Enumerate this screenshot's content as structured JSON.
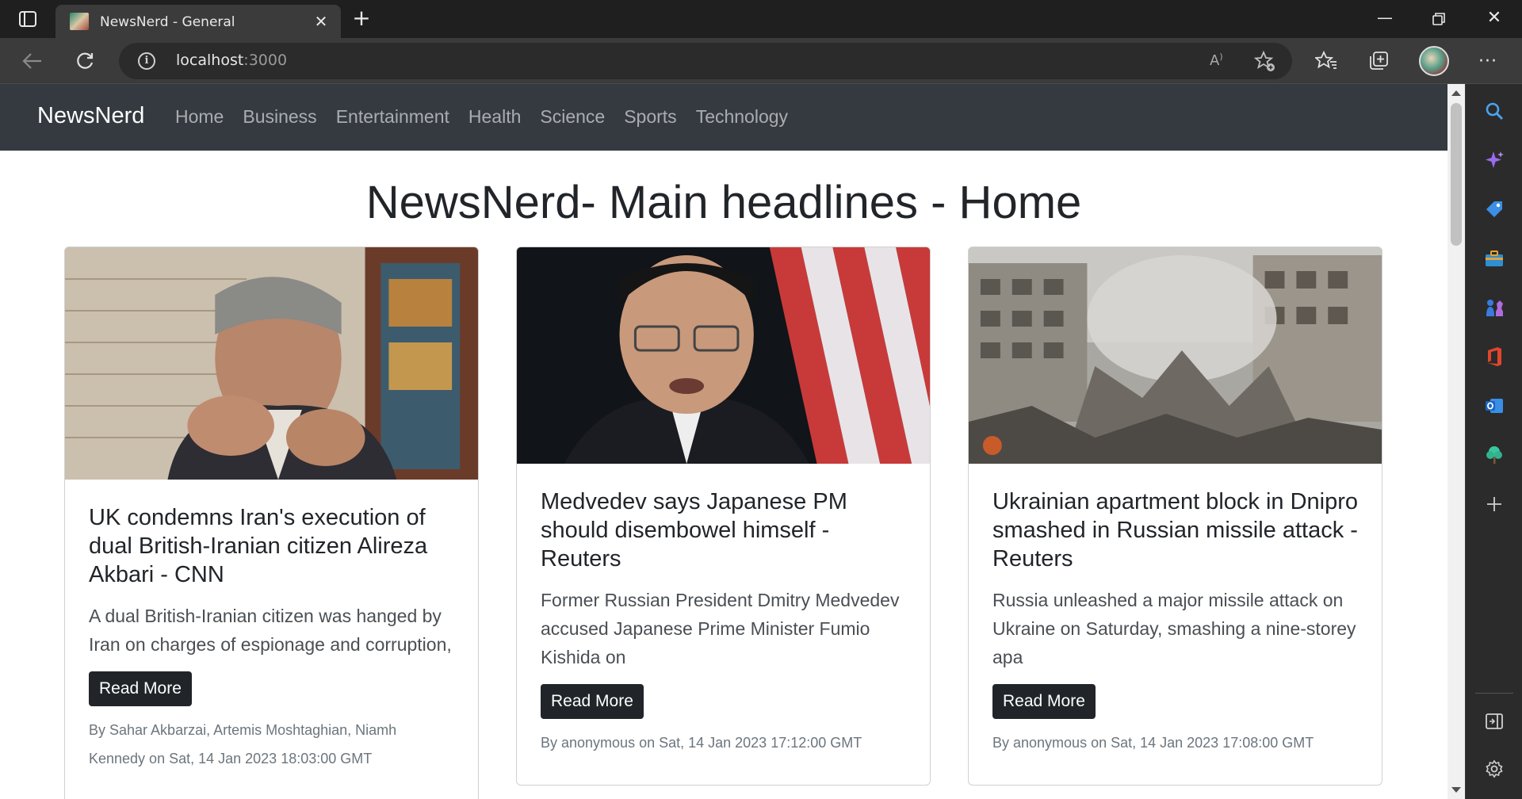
{
  "browser": {
    "tab_title": "NewsNerd - General",
    "url_host": "localhost",
    "url_port": ":3000"
  },
  "site": {
    "brand": "NewsNerd",
    "nav": [
      "Home",
      "Business",
      "Entertainment",
      "Health",
      "Science",
      "Sports",
      "Technology"
    ],
    "heading": "NewsNerd- Main headlines - Home"
  },
  "articles": [
    {
      "title": "UK condemns Iran's execution of dual British-Iranian citizen Alireza Akbari - CNN",
      "description": "A dual British-Iranian citizen was hanged by Iran on charges of espionage and corruption,",
      "button": "Read More",
      "meta": "By Sahar Akbarzai, Artemis Moshtaghian, Niamh Kennedy on Sat, 14 Jan 2023 18:03:00 GMT",
      "image": "portrait-man-gesturing"
    },
    {
      "title": "Medvedev says Japanese PM should disembowel himself - Reuters",
      "description": "Former Russian President Dmitry Medvedev accused Japanese Prime Minister Fumio Kishida on",
      "button": "Read More",
      "meta": "By anonymous on Sat, 14 Jan 2023 17:12:00 GMT",
      "image": "portrait-man-flag"
    },
    {
      "title": "Ukrainian apartment block in Dnipro smashed in Russian missile attack - Reuters",
      "description": "Russia unleashed a major missile attack on Ukraine on Saturday, smashing a nine-storey apa",
      "button": "Read More",
      "meta": "By anonymous on Sat, 14 Jan 2023 17:08:00 GMT",
      "image": "destroyed-building"
    }
  ],
  "colors": {
    "navbar": "#343a40",
    "button": "#212529",
    "meta_text": "#6c757d"
  }
}
